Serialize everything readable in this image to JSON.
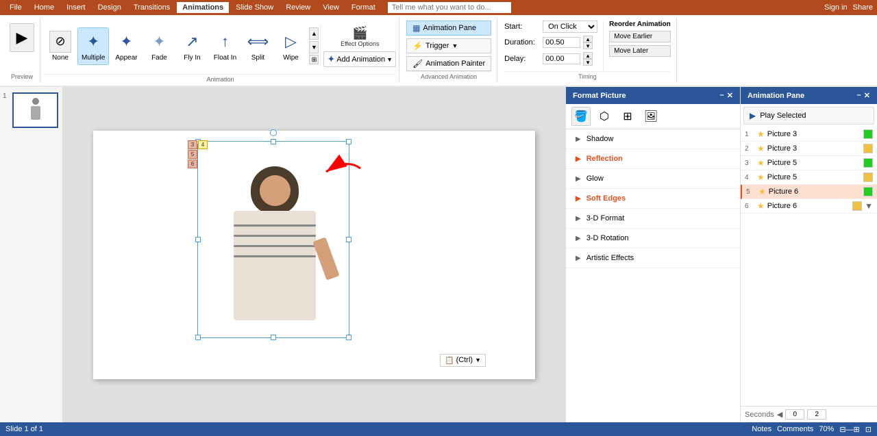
{
  "titlebar": {
    "tabs": [
      "File",
      "Home",
      "Insert",
      "Design",
      "Transitions",
      "Animations",
      "Slide Show",
      "Review",
      "View",
      "Format"
    ],
    "active_tab": "Animations",
    "search_placeholder": "Tell me what you want to do...",
    "sign_in": "Sign in",
    "share": "Share"
  },
  "animation_tools": {
    "none_label": "None",
    "multiple_label": "Multiple",
    "appear_label": "Appear",
    "fade_label": "Fade",
    "fly_in_label": "Fly In",
    "float_in_label": "Float In",
    "split_label": "Split",
    "wipe_label": "Wipe",
    "effect_options_label": "Effect Options",
    "add_animation_label": "Add Animation",
    "animation_painter_label": "Animation Painter",
    "animation_pane_label": "Animation Pane",
    "trigger_label": "Trigger",
    "section_label": "Animation"
  },
  "advanced_animation": {
    "label": "Advanced Animation"
  },
  "timing": {
    "label": "Timing",
    "start_label": "Start:",
    "start_value": "On Click",
    "duration_label": "Duration:",
    "duration_value": "00.50",
    "delay_label": "Delay:",
    "delay_value": "00.00",
    "reorder_label": "Reorder Animation",
    "move_earlier": "Move Earlier",
    "move_later": "Move Later"
  },
  "format_picture": {
    "title": "Format Picture",
    "tabs": [
      "fill-icon",
      "shape-icon",
      "layout-icon",
      "picture-icon"
    ],
    "items": [
      {
        "label": "Shadow",
        "expanded": false
      },
      {
        "label": "Reflection",
        "expanded": false,
        "highlighted": true
      },
      {
        "label": "Glow",
        "expanded": false
      },
      {
        "label": "Soft Edges",
        "expanded": false,
        "highlighted": true
      },
      {
        "label": "3-D Format",
        "expanded": false
      },
      {
        "label": "3-D Rotation",
        "expanded": false
      },
      {
        "label": "Artistic Effects",
        "expanded": false
      }
    ]
  },
  "animation_pane": {
    "title": "Animation Pane",
    "play_selected": "Play Selected",
    "items": [
      {
        "num": "1",
        "name": "Picture 3",
        "color": "#22cc22",
        "selected": false
      },
      {
        "num": "2",
        "name": "Picture 3",
        "color": "#f0c040",
        "selected": false
      },
      {
        "num": "3",
        "name": "Picture 5",
        "color": "#22cc22",
        "selected": false
      },
      {
        "num": "4",
        "name": "Picture 5",
        "color": "#f0c040",
        "selected": false
      },
      {
        "num": "5",
        "name": "Picture 6",
        "color": "#22cc22",
        "selected": true
      },
      {
        "num": "6",
        "name": "Picture 6",
        "color": "#f0c040",
        "selected": false
      }
    ],
    "footer_seconds": "Seconds",
    "footer_val1": "0",
    "footer_val2": "2"
  },
  "slide": {
    "num": 1,
    "anim_badges": [
      "3",
      "4",
      "5",
      "6"
    ]
  }
}
